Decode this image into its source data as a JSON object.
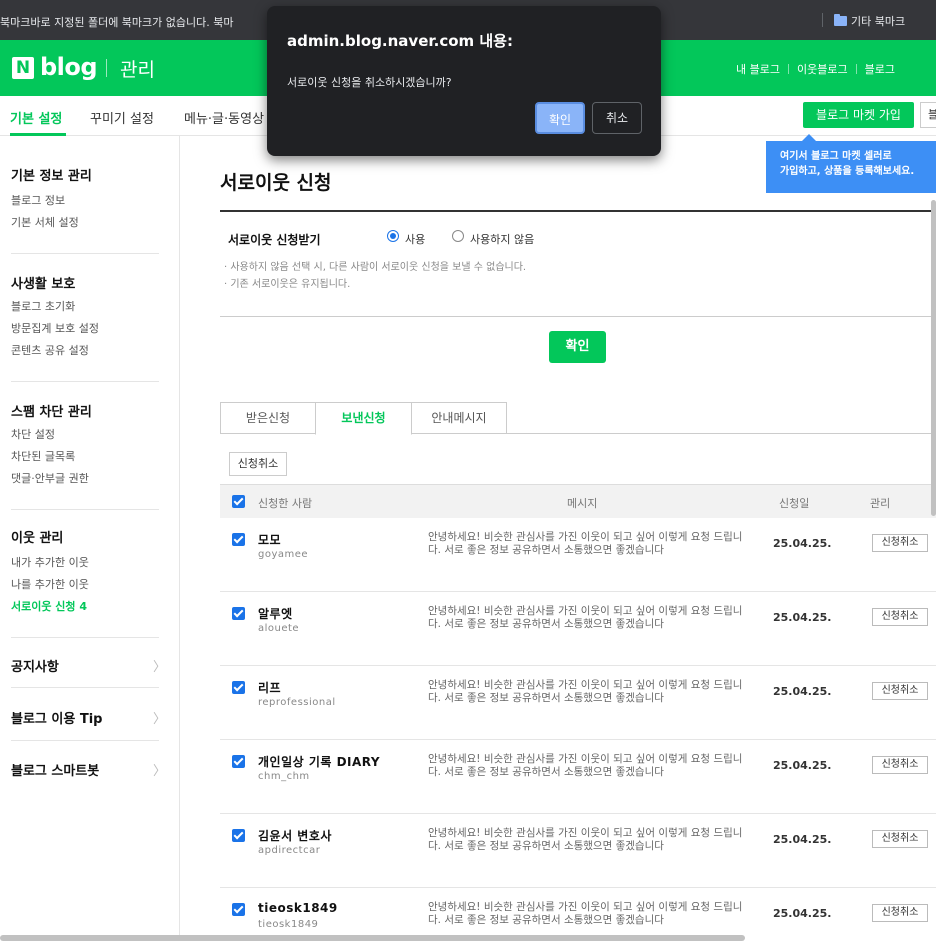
{
  "bookmark_bar": {
    "message": "북마크바로 지정된 폴더에 북마크가 없습니다. 북마",
    "other_bookmarks": "기타 북마크"
  },
  "header": {
    "logo_n": "N",
    "logo_blog": "blog",
    "manage": "관리",
    "links": [
      "내 블로그",
      "이웃블로그",
      "블로그"
    ]
  },
  "tabs": [
    {
      "label": "기본 설정"
    },
    {
      "label": "꾸미기 설정"
    },
    {
      "label": "메뉴·글·동영상 "
    }
  ],
  "market_button": "블로그 마켓 가입",
  "market_button_edge": "블",
  "tooltip": {
    "line1": "여기서 블로그 마켓 셀러로",
    "line2": "가입하고, 상품을 등록해보세요."
  },
  "sidebar": {
    "sections": [
      {
        "title": "기본 정보 관리",
        "items": [
          "블로그 정보",
          "기본 서체 설정"
        ]
      },
      {
        "title": "사생활 보호",
        "items": [
          "블로그 초기화",
          "방문집계 보호 설정",
          "콘텐츠 공유 설정"
        ]
      },
      {
        "title": "스팸 차단 관리",
        "items": [
          "차단 설정",
          "차단된 글목록",
          "댓글·안부글 권한"
        ]
      },
      {
        "title": "이웃 관리",
        "items": [
          "내가 추가한 이웃",
          "나를 추가한 이웃",
          "서로이웃 신청 4"
        ]
      }
    ],
    "links": [
      "공지사항",
      "블로그 이용 Tip",
      "블로그 스마트봇"
    ],
    "arrow": "〉"
  },
  "main": {
    "title": "서로이웃 신청",
    "option_label": "서로이웃 신청받기",
    "radio_use": "사용",
    "radio_unused": "사용하지 않음",
    "note1": "· 사용하지 않음 선택 시, 다른 사람이 서로이웃 신청을 보낼 수 없습니다.",
    "note2": "· 기존 서로이웃은 유지됩니다.",
    "confirm": "확인",
    "subtabs": [
      "받은신청",
      "보낸신청",
      "안내메시지"
    ],
    "cancel_button": "신청취소"
  },
  "table": {
    "headers": {
      "person": "신청한 사람",
      "message": "메시지",
      "date": "신청일",
      "manage": "관리"
    },
    "rows": [
      {
        "name": "모모",
        "id": "goyamee",
        "message": "안녕하세요! 비슷한 관심사를 가진 이웃이 되고 싶어 이렇게 요청 드립니다. 서로 좋은 정보 공유하면서 소통했으면 좋겠습니다",
        "date": "25.04.25.",
        "action": "신청취소"
      },
      {
        "name": "알루엣",
        "id": "alouete",
        "message": "안녕하세요! 비슷한 관심사를 가진 이웃이 되고 싶어 이렇게 요청 드립니다. 서로 좋은 정보 공유하면서 소통했으면 좋겠습니다",
        "date": "25.04.25.",
        "action": "신청취소"
      },
      {
        "name": "리프",
        "id": "reprofessional",
        "message": "안녕하세요! 비슷한 관심사를 가진 이웃이 되고 싶어 이렇게 요청 드립니다. 서로 좋은 정보 공유하면서 소통했으면 좋겠습니다",
        "date": "25.04.25.",
        "action": "신청취소"
      },
      {
        "name": "개인일상 기록 DIARY",
        "id": "chm_chm",
        "message": "안녕하세요! 비슷한 관심사를 가진 이웃이 되고 싶어 이렇게 요청 드립니다. 서로 좋은 정보 공유하면서 소통했으면 좋겠습니다",
        "date": "25.04.25.",
        "action": "신청취소"
      },
      {
        "name": "김윤서 변호사",
        "id": "apdirectcar",
        "message": "안녕하세요! 비슷한 관심사를 가진 이웃이 되고 싶어 이렇게 요청 드립니다. 서로 좋은 정보 공유하면서 소통했으면 좋겠습니다",
        "date": "25.04.25.",
        "action": "신청취소"
      },
      {
        "name": "tieosk1849",
        "id": "tieosk1849",
        "message": "안녕하세요! 비슷한 관심사를 가진 이웃이 되고 싶어 이렇게 요청 드립니다. 서로 좋은 정보 공유하면서 소통했으면 좋겠습니다",
        "date": "25.04.25.",
        "action": "신청취소"
      }
    ]
  },
  "dialog": {
    "title": "admin.blog.naver.com 내용:",
    "message": "서로이웃 신청을 취소하시겠습니까?",
    "ok": "확인",
    "cancel": "취소"
  },
  "colors": {
    "brand": "#03c75a",
    "dialog_bg": "#202124",
    "dialog_ok": "#8ab4f8",
    "checkbox": "#1a73e8",
    "tooltip": "#3d8ff5"
  }
}
